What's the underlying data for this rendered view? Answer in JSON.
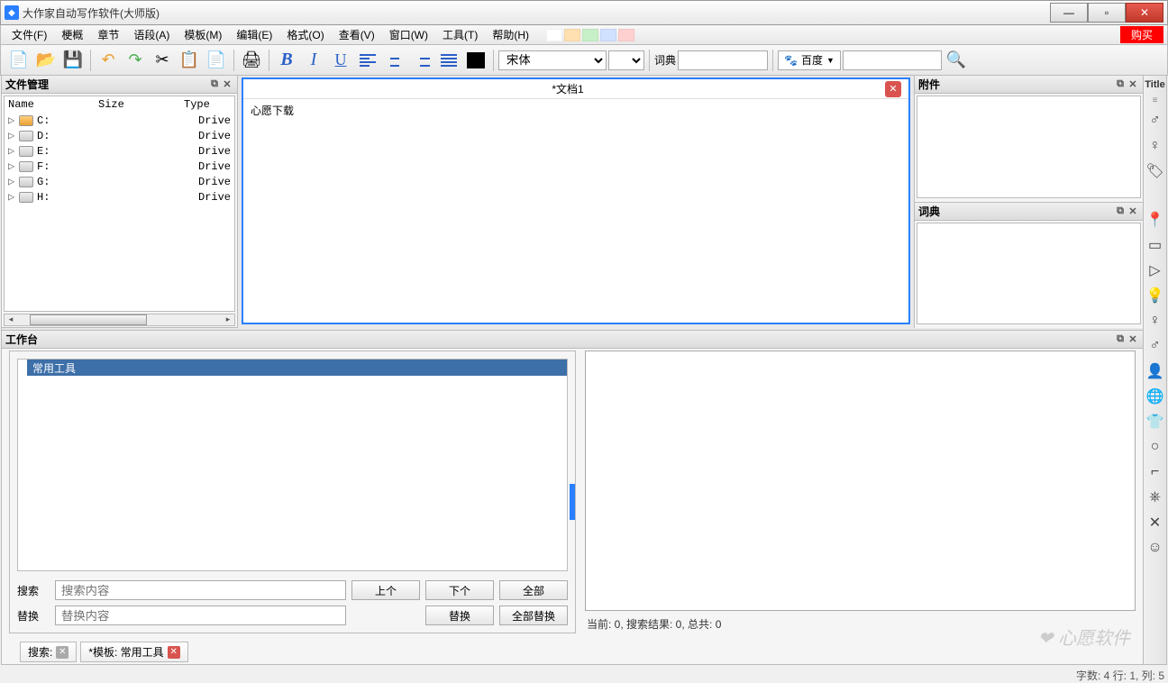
{
  "window": {
    "title": "大作家自动写作软件(大师版)"
  },
  "menu": {
    "file": "文件(F)",
    "outline": "梗概",
    "chapter": "章节",
    "paragraph": "语段(A)",
    "template": "模板(M)",
    "edit": "编辑(E)",
    "format": "格式(O)",
    "view": "查看(V)",
    "window": "窗口(W)",
    "tools": "工具(T)",
    "help": "帮助(H)",
    "buy": "购买"
  },
  "toolbar": {
    "font_value": "宋体",
    "dict_label": "词典",
    "search_engine": "百度"
  },
  "left_panel": {
    "title": "文件管理",
    "cols": {
      "name": "Name",
      "size": "Size",
      "type": "Type"
    },
    "drives": [
      {
        "name": "C:",
        "type": "Drive"
      },
      {
        "name": "D:",
        "type": "Drive"
      },
      {
        "name": "E:",
        "type": "Drive"
      },
      {
        "name": "F:",
        "type": "Drive"
      },
      {
        "name": "G:",
        "type": "Drive"
      },
      {
        "name": "H:",
        "type": "Drive"
      }
    ]
  },
  "editor": {
    "tab_title": "*文档1",
    "content": "心愿下载"
  },
  "right": {
    "attach_title": "附件",
    "dict_title": "词典"
  },
  "sidebar": {
    "title": "Title"
  },
  "workbench": {
    "title": "工作台",
    "tab": "常用工具",
    "search_label": "搜索",
    "search_placeholder": "搜索内容",
    "replace_label": "替换",
    "replace_placeholder": "替换内容",
    "prev": "上个",
    "next": "下个",
    "all": "全部",
    "replace_btn": "替换",
    "replace_all": "全部替换",
    "status": "当前: 0, 搜索结果: 0, 总共: 0"
  },
  "bottom_tabs": {
    "search": "搜索:",
    "template": "*模板: 常用工具"
  },
  "statusbar": {
    "text": "字数: 4 行: 1, 列: 5"
  },
  "watermark": "心愿软件"
}
